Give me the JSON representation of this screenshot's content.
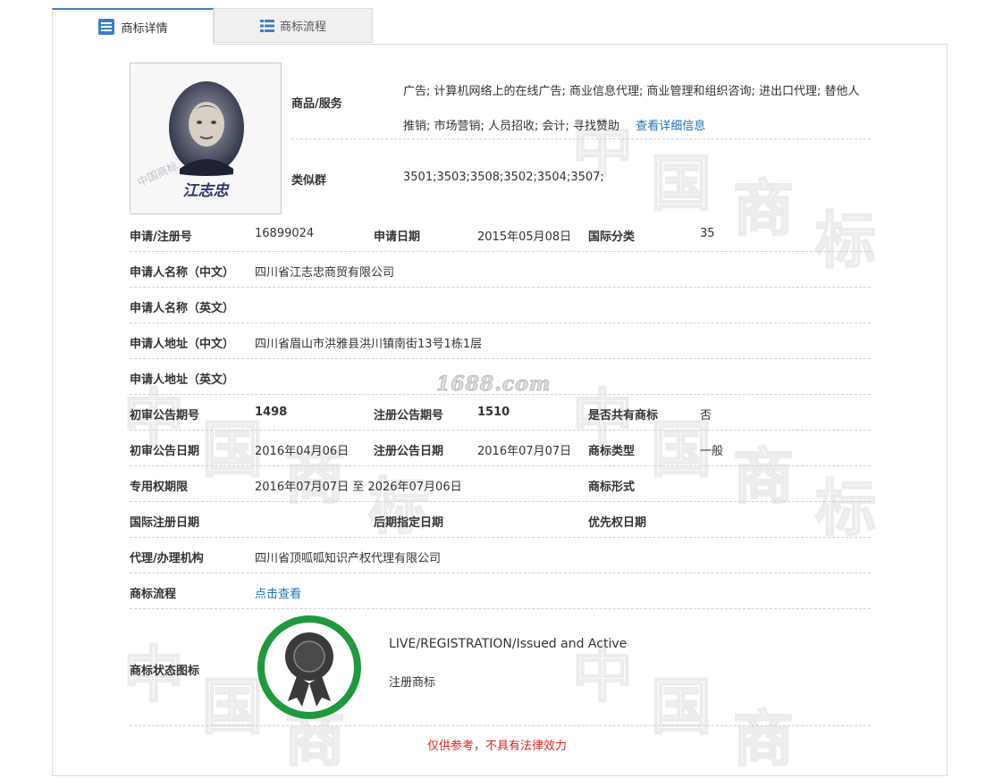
{
  "tabs": [
    {
      "label": "商标详情",
      "icon": "document-list-icon",
      "active": true
    },
    {
      "label": "商标流程",
      "icon": "list-icon",
      "active": false
    }
  ],
  "accent_color": "#3d7fc4",
  "link_color": "#1a73b8",
  "watermark": {
    "chars": [
      "中",
      "国",
      "商",
      "标"
    ],
    "site": "1688.com"
  },
  "photo": {
    "signature": "江志忠",
    "stamp_text": "中国商标"
  },
  "goods_services": {
    "label": "商品/服务",
    "text": "广告; 计算机网络上的在线广告; 商业信息代理; 商业管理和组织咨询; 进出口代理; 替他人推销; 市场营销; 人员招收; 会计; 寻找赞助",
    "more_link": "查看详细信息"
  },
  "similar_group": {
    "label": "类似群",
    "value": "3501;3503;3508;3502;3504;3507;"
  },
  "fields": {
    "reg_no": {
      "label": "申请/注册号",
      "value": "16899024"
    },
    "apply_date": {
      "label": "申请日期",
      "value": "2015年05月08日"
    },
    "intl_class": {
      "label": "国际分类",
      "value": "35"
    },
    "applicant_cn": {
      "label": "申请人名称（中文）",
      "value": "四川省江志忠商贸有限公司"
    },
    "applicant_en": {
      "label": "申请人名称（英文）",
      "value": ""
    },
    "address_cn": {
      "label": "申请人地址（中文）",
      "value": "四川省眉山市洪雅县洪川镇南街13号1栋1层"
    },
    "address_en": {
      "label": "申请人地址（英文）",
      "value": ""
    },
    "prelim_pub_no": {
      "label": "初审公告期号",
      "value": "1498"
    },
    "reg_pub_no": {
      "label": "注册公告期号",
      "value": "1510"
    },
    "shared": {
      "label": "是否共有商标",
      "value": "否"
    },
    "prelim_pub_date": {
      "label": "初审公告日期",
      "value": "2016年04月06日"
    },
    "reg_pub_date": {
      "label": "注册公告日期",
      "value": "2016年07月07日"
    },
    "tm_type": {
      "label": "商标类型",
      "value": "一般"
    },
    "exclusive_period": {
      "label": "专用权期限",
      "value": "2016年07月07日 至 2026年07月06日"
    },
    "tm_form": {
      "label": "商标形式",
      "value": ""
    },
    "intl_reg_date": {
      "label": "国际注册日期",
      "value": ""
    },
    "later_designation": {
      "label": "后期指定日期",
      "value": ""
    },
    "priority_date": {
      "label": "优先权日期",
      "value": ""
    },
    "agent": {
      "label": "代理/办理机构",
      "value": "四川省顶呱呱知识产权代理有限公司"
    },
    "process": {
      "label": "商标流程",
      "value": "点击查看"
    }
  },
  "status": {
    "label": "商标状态图标",
    "en": "LIVE/REGISTRATION/Issued and Active",
    "cn": "注册商标",
    "icon": "award-ribbon-icon",
    "ring_color": "#1e9a3c"
  },
  "notice": "仅供参考，不具有法律效力",
  "notice_color": "#e02020"
}
